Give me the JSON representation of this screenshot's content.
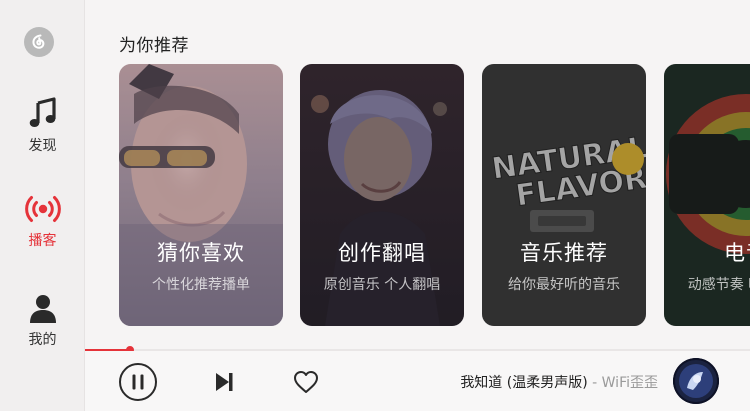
{
  "sidebar": {
    "items": [
      {
        "label": "发现",
        "icon": "music-note-icon",
        "active": false
      },
      {
        "label": "播客",
        "icon": "broadcast-icon",
        "active": true
      },
      {
        "label": "我的",
        "icon": "user-icon",
        "active": false
      }
    ]
  },
  "main": {
    "section_title": "为你推荐",
    "cards": [
      {
        "title": "猜你喜欢",
        "subtitle": "个性化推荐播单"
      },
      {
        "title": "创作翻唱",
        "subtitle": "原创音乐 个人翻唱"
      },
      {
        "title": "音乐推荐",
        "subtitle": "给你最好听的音乐"
      },
      {
        "title": "电音",
        "subtitle": "动感节奏 嗨翻全场"
      }
    ]
  },
  "player": {
    "progress": 0.068,
    "song_title": "我知道 (温柔男声版)",
    "separator": " - ",
    "artist": "WiFi歪歪"
  },
  "colors": {
    "accent": "#e5333a",
    "background": "#f6f4f4"
  }
}
